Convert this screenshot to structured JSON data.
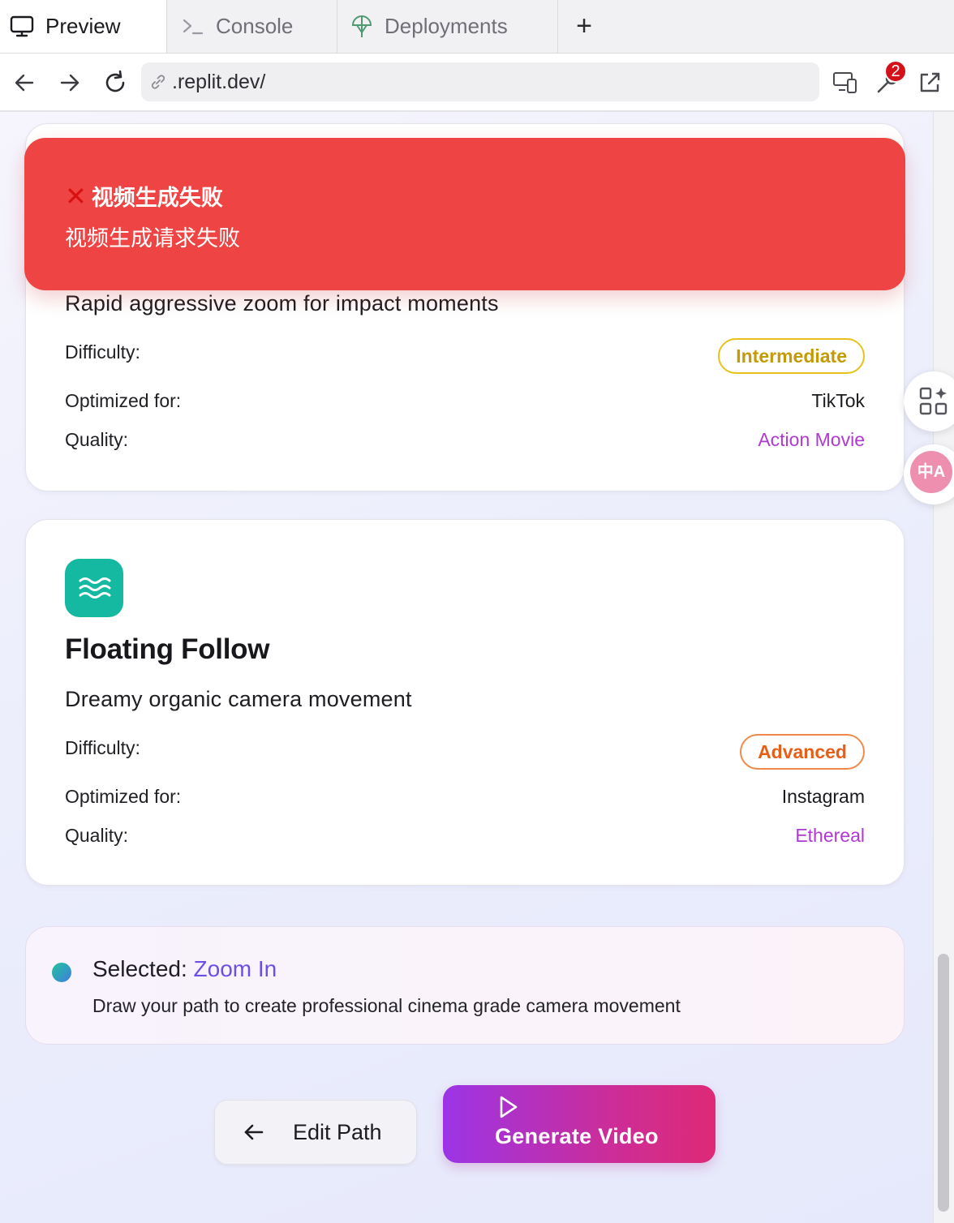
{
  "browser": {
    "tabs": [
      {
        "label": "Preview",
        "icon": "monitor-icon",
        "active": true
      },
      {
        "label": "Console",
        "icon": "terminal-icon",
        "active": false
      },
      {
        "label": "Deployments",
        "icon": "deploy-icon",
        "active": false
      }
    ],
    "add_tab_label": "+",
    "url": ".replit.dev/",
    "devtools_badge": "2"
  },
  "toast": {
    "icon": "✕",
    "title": "视频生成失败",
    "message": "视频生成请求失败",
    "color": "#ef4444"
  },
  "cards": [
    {
      "description": "Rapid aggressive zoom for impact moments",
      "difficulty_label": "Difficulty:",
      "difficulty": "Intermediate",
      "optimized_label": "Optimized for:",
      "optimized": "TikTok",
      "quality_label": "Quality:",
      "quality": "Action Movie"
    },
    {
      "icon": "waves-icon",
      "title": "Floating Follow",
      "description": "Dreamy organic camera movement",
      "difficulty_label": "Difficulty:",
      "difficulty": "Advanced",
      "optimized_label": "Optimized for:",
      "optimized": "Instagram",
      "quality_label": "Quality:",
      "quality": "Ethereal"
    }
  ],
  "selection": {
    "prefix": "Selected:",
    "name": "Zoom In",
    "hint": "Draw your path to create professional cinema grade camera movement"
  },
  "actions": {
    "edit_path": "Edit Path",
    "generate_video": "Generate Video"
  },
  "floating": {
    "translate_label": "中A"
  }
}
